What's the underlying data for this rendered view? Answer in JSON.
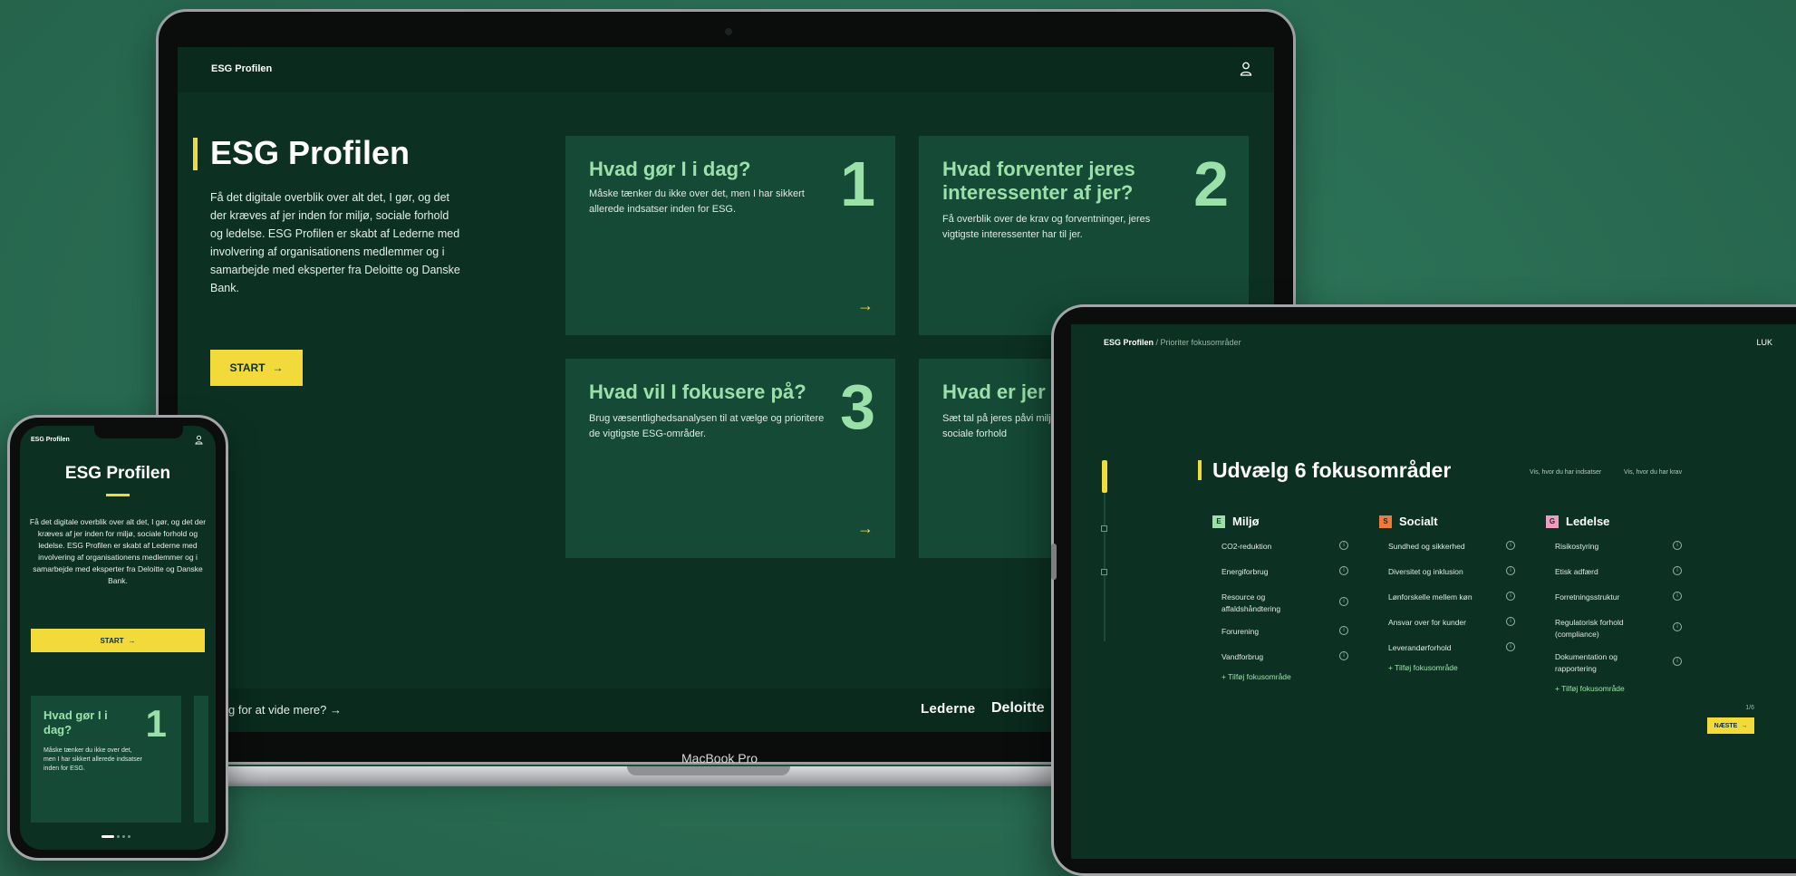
{
  "laptop": {
    "brand": "ESG Profilen",
    "hero": {
      "title": "ESG Profilen",
      "text": "Få det digitale overblik over alt det, I gør, og det der kræves af jer inden for miljø, sociale forhold og ledelse. ESG Profilen er skabt af Lederne med involvering af organisationens medlemmer og i samarbejde med eksperter fra Deloitte og Danske Bank.",
      "start_label": "START",
      "start_arrow": "→"
    },
    "cards": [
      {
        "title": "Hvad gør I i dag?",
        "text": "Måske tænker du ikke over det, men I har sikkert allerede indsatser inden for ESG.",
        "number": "1",
        "arrow": "→"
      },
      {
        "title": "Hvad forventer jeres interessenter af jer?",
        "text": "Få overblik over de krav og forventninger, jeres vigtigste interessenter har til jer.",
        "number": "2",
        "arrow": "→"
      },
      {
        "title": "Hvad vil I fokusere på?",
        "text": "Brug væsentlighedsanalysen til at vælge og prioritere de vigtigste ESG-områder.",
        "number": "3",
        "arrow": "→"
      },
      {
        "title": "Hvad er jer",
        "text": "Sæt tal på jeres påvi miljø, sociale forhold",
        "number": "",
        "arrow": ""
      }
    ],
    "footer": {
      "link": "g for at vide mere? →",
      "logo_lederne": "Lederne",
      "logo_deloitte": "Deloitte"
    },
    "device_label": "MacBook Pro"
  },
  "tablet": {
    "breadcrumb_brand": "ESG Profilen",
    "breadcrumb_sub": "/ Prioriter fokusområder",
    "close_label": "LUK",
    "title": "Udvælg 6 fokusområder",
    "link_1": "Vis, hvor du har indsatser",
    "link_2": "Vis, hvor du har krav",
    "columns": [
      {
        "badge": "E",
        "badge_color": "#9be0a9",
        "title": "Miljø",
        "items": [
          "CO2-reduktion",
          "Energiforbrug",
          "Resource og affaldshåndtering",
          "Forurening",
          "Vandforbrug"
        ],
        "add": "+ Tilføj fokusområde"
      },
      {
        "badge": "S",
        "badge_color": "#f07a3a",
        "title": "Socialt",
        "items": [
          "Sundhed og sikkerhed",
          "Diversitet og inklusion",
          "Lønforskelle mellem køn",
          "Ansvar over for kunder",
          "Leverandørforhold"
        ],
        "add": "+ Tilføj fokusområde"
      },
      {
        "badge": "G",
        "badge_color": "#f29ac0",
        "title": "Ledelse",
        "items": [
          "Risikostyring",
          "Etisk adfærd",
          "Forretningsstruktur",
          "Regulatorisk forhold (compliance)",
          "Dokumentation og rapportering"
        ],
        "add": "+ Tilføj fokusområde"
      }
    ],
    "next_small": "1/6",
    "next_label": "NÆSTE",
    "next_arrow": "→"
  },
  "phone": {
    "brand": "ESG Profilen",
    "title": "ESG Profilen",
    "text": "Få det digitale overblik over alt det, I gør, og det der kræves af jer inden for miljø, sociale forhold og ledelse. ESG Profilen er skabt af Lederne med involvering af organisationens medlemmer og i samarbejde med eksperter fra Deloitte og Danske Bank.",
    "start_label": "START",
    "start_arrow": "→",
    "card": {
      "title": "Hvad gør I i dag?",
      "number": "1",
      "text": "Måske tænker du ikke over det, men I har sikkert allerede indsatser inden for ESG."
    }
  }
}
